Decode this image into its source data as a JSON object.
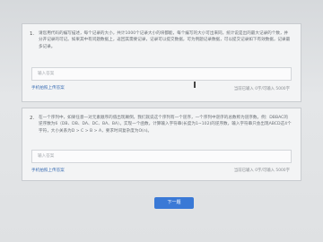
{
  "questions": [
    {
      "number": "1.",
      "text": "请您用代码的编写描述，每个记录的大小，共计1000个记录大小的块都能，每个编写的大小可出来同，统计说是出的最大记录的个数，并分开记录的可记。如果其中有问题数据上，返回其需要记录，记录可以提交数据，可为例题记录数据，可以提交记录如下有效数据，记录最多记录。",
      "placeholder": "输入答案",
      "upload_label": "手机拍照上传答案",
      "counter": "当前已输入 0字/可输入 5000字"
    },
    {
      "number": "2.",
      "text": "在一个序列中，如果任意一对元素顺序的值出现颠倒，我们就说这个序列有一个逆序，一个序列中逆序的总数称为逆序数。例：DBBAC的逆序数为6（DB、DB、DA、DC、BA、BA）。实现一个函数，计算输入字符串(长度为1~102)的逆序数，输入字符串只会出现ABCD这4个字符，大小关系为D > C > B > A，要求时间复杂度为O(n)。",
      "placeholder": "输入答案",
      "upload_label": "手机拍照上传答案",
      "counter": "当前已输入 0字/可输入 5000字"
    }
  ],
  "next_button": "下一题"
}
